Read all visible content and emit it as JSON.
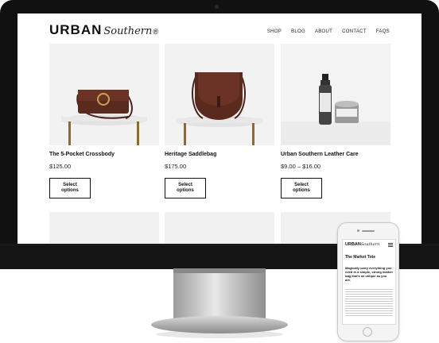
{
  "site": {
    "logo_main": "URBAN",
    "logo_script": "Southern",
    "logo_mark": "®",
    "nav": [
      "SHOP",
      "BLOG",
      "ABOUT",
      "CONTACT",
      "FAQS"
    ]
  },
  "products": [
    {
      "name": "The 5-Pocket Crossbody",
      "price": "$125.00",
      "button": "Select options"
    },
    {
      "name": "Heritage Saddlebag",
      "price": "$175.00",
      "button": "Select options"
    },
    {
      "name": "Urban Southern Leather Care",
      "price": "$9.00 – $16.00",
      "button": "Select options"
    }
  ],
  "phone": {
    "logo_main": "URBAN",
    "logo_script": "Southern",
    "post_title": "The Market Tote",
    "post_intro": "Magically carry everything you need in a simple, strong leather bag that's as unique as you are."
  },
  "colors": {
    "leather": "#5b2a1f",
    "monitor": "#111111"
  }
}
